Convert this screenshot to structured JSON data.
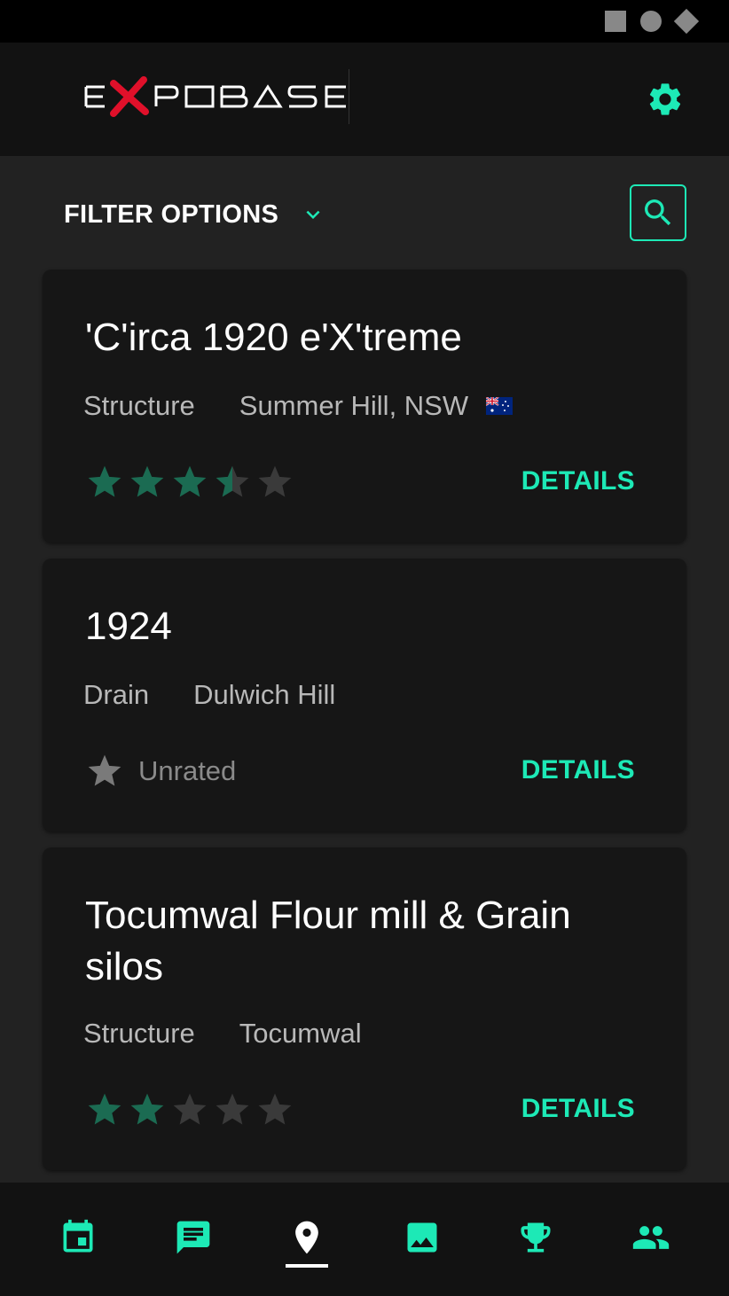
{
  "app": {
    "logo_text": "EXPOBASE",
    "accent_color": "#1de9b6",
    "logo_x_color": "#e0102a"
  },
  "filter": {
    "label": "FILTER OPTIONS",
    "icon": "chevron-down-icon",
    "search_icon": "search-icon"
  },
  "header": {
    "settings_icon": "gear-icon"
  },
  "cards": [
    {
      "title": "'C'irca 1920 e'X'treme",
      "type": "Structure",
      "location": "Summer Hill, NSW",
      "flag": "australia-flag",
      "rating": 3.5,
      "rating_max": 5,
      "details_label": "DETAILS"
    },
    {
      "title": "1924",
      "type": "Drain",
      "location": "Dulwich Hill",
      "rating": null,
      "unrated_label": "Unrated",
      "details_label": "DETAILS"
    },
    {
      "title": "Tocumwal Flour mill & Grain silos",
      "type": "Structure",
      "location": "Tocumwal",
      "rating": 2,
      "rating_max": 5,
      "details_label": "DETAILS"
    }
  ],
  "bottom_nav": {
    "items": [
      "calendar-icon",
      "message-icon",
      "map-pin-icon",
      "image-icon",
      "trophy-icon",
      "people-icon"
    ],
    "active": "map-pin-icon"
  }
}
